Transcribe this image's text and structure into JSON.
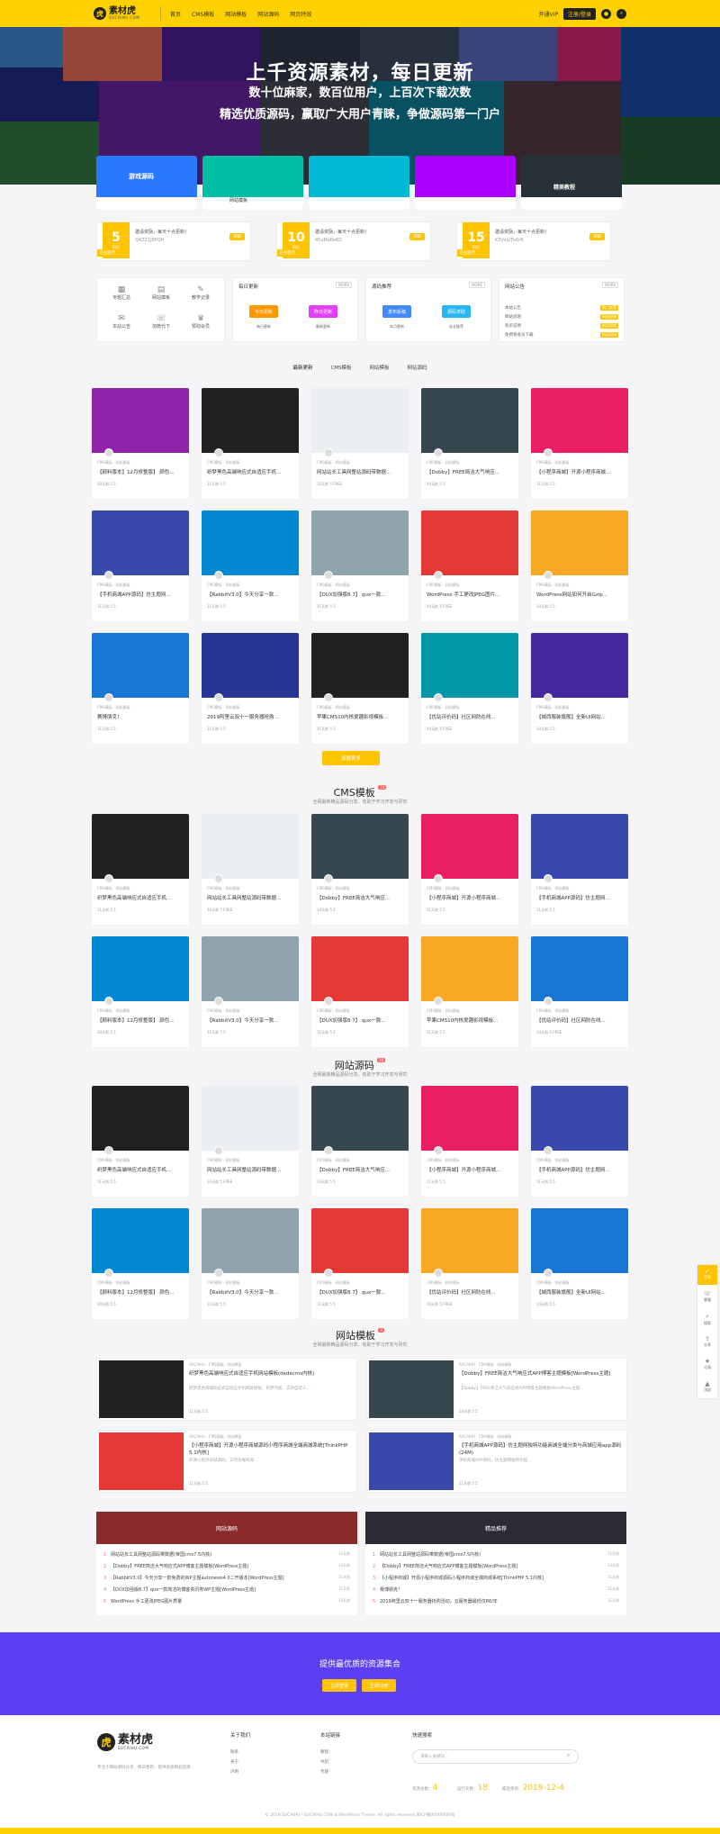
{
  "colors": {
    "brand_yellow": "#ffd100",
    "accent_orange": "#ffc400",
    "promo_purple": "#5b3ff0",
    "dark": "#222222"
  },
  "header": {
    "logo_text": "素材虎",
    "logo_sub": "SUCAIHU.COM",
    "nav": [
      "首页",
      "CMS模板",
      "网站模板",
      "网站源码",
      "网页特效"
    ],
    "vip_label": "开通VIP",
    "login_label": "注册/登录"
  },
  "hero": {
    "title": "上千资源素材，每日更新",
    "sub1": "数十位麻家，数百位用户，上百次下载次数",
    "sub2": "精选优质源码，赢取广大用户青睐，争做源码第一门户",
    "categories": [
      "游戏源码",
      "网站模板",
      "",
      "",
      "",
      "精美教程"
    ]
  },
  "stats": [
    {
      "num": "5",
      "unit": "积分",
      "text": "邀请奖励，每天十点更新！",
      "code": "Q4ZZ1J8PQH",
      "btn": "领取",
      "tag": "已经使用"
    },
    {
      "num": "10",
      "unit": "积分",
      "text": "邀请奖励，每天十点更新！",
      "code": "45xMeRe6D",
      "btn": "领取",
      "tag": "已经使用"
    },
    {
      "num": "15",
      "unit": "积分",
      "text": "邀请奖励，每天十点更新！",
      "code": "K3VsjuTk6rR",
      "btn": "领取",
      "tag": "已经使用"
    }
  ],
  "quick_grid": [
    "专题汇总",
    "网站模板",
    "教学记录",
    "本站公告",
    "加微代下",
    "赞助会员"
  ],
  "panels": [
    {
      "title": "每日更新",
      "more": "MORE",
      "buttons": [
        "今日更新",
        "昨日更新"
      ],
      "caps": [
        "每日更新",
        "最新更新"
      ]
    },
    {
      "title": "源码推荐",
      "more": "MORE",
      "buttons": [
        "发布投稿",
        "源码求助"
      ],
      "caps": [
        "本月更新",
        "站长推荐"
      ]
    },
    {
      "title": "网站公告",
      "more": "MORE"
    }
  ],
  "notices": [
    {
      "text": "本站公告",
      "badge": "热门推荐"
    },
    {
      "text": "网站说明",
      "badge": "网站说明"
    },
    {
      "text": "购买说明",
      "badge": "购买须知"
    },
    {
      "text": "免费将会员下载",
      "badge": "购买须知"
    }
  ],
  "tabs": [
    "最新更新",
    "CMS模板",
    "网站模板",
    "网站源码"
  ],
  "latest_posts": [
    {
      "title": "【颜料版本】12月修整版】 颜色...",
      "meta": "CMS模板 · 网站模板",
      "stats": "20天前  5  5"
    },
    {
      "title": "织梦黑色高端响应式自适应手机...",
      "meta": "CMS模板 · 网站模板",
      "stats": "11天前  5  5"
    },
    {
      "title": "网站站长工具网整站源码带数据...",
      "meta": "CMS模板 · 网站模板",
      "stats": "10天前  5  FREE"
    },
    {
      "title": "【Dobby】FREE简洁大气响应...",
      "meta": "CMS模板 · 网站模板",
      "stats": "14天前  5  5"
    },
    {
      "title": "【小程序商城】开源小程序商城...",
      "meta": "CMS模板 · 网站模板",
      "stats": "11天前  5  5"
    },
    {
      "title": "【手机商城APP源码】仿主题网...",
      "meta": "CMS模板 · 网站模板",
      "stats": "11天前  5  5"
    },
    {
      "title": "【RabbitV3.0】今天分享一款...",
      "meta": "CMS模板 · 网站模板",
      "stats": "11天前  5  5"
    },
    {
      "title": "【DUX加强版8.7】 qux一款...",
      "meta": "CMS模板 · 网站模板",
      "stats": "11天前  5  5"
    },
    {
      "title": "WordPress 手工更改JPEG图片...",
      "meta": "CMS模板 · 网站模板",
      "stats": "14天前  5  FREE"
    },
    {
      "title": "WordPress网站如何开启Gzip...",
      "meta": "CMS模板 · 网站模板",
      "stats": "14天前  5  5"
    },
    {
      "title": "赛博朋克！",
      "meta": "CMS模板 · 网站模板",
      "stats": "11天前  5  5"
    },
    {
      "title": "2019阿里云双十一服务器抢购...",
      "meta": "CMS模板 · 网站模板",
      "stats": "11天前  5  5"
    },
    {
      "title": "苹果CMS10内核爱趣影视模板...",
      "meta": "CMS模板 · 网站模板",
      "stats": "11天前  5  5"
    },
    {
      "title": "【优站评价码】社区网防在线...",
      "meta": "CMS模板 · 网站模板",
      "stats": "14天前  5  FREE"
    },
    {
      "title": "【城西服装旗舰】全新UI网站...",
      "meta": "CMS模板 · 网站模板",
      "stats": "14天前  5  5"
    }
  ],
  "more_button": "加载更多",
  "cms_section": {
    "title": "CMS模板",
    "badge": "10",
    "desc": "全网最新精品源码分享，有助于学习开发与研究",
    "posts": [
      {
        "title": "织梦黑色高端响应式自适应手机...",
        "meta": "CMS模板 · 网站模板",
        "stats": "11天前  5  5"
      },
      {
        "title": "网站站长工具网整站源码带数据...",
        "meta": "CMS模板 · 网站模板",
        "stats": "10天前  5  FREE"
      },
      {
        "title": "【Dobby】FREE简洁大气响应...",
        "meta": "CMS模板 · 网站模板",
        "stats": "14天前  5  5"
      },
      {
        "title": "【小程序商城】开源小程序商城...",
        "meta": "CMS模板 · 网站模板",
        "stats": "11天前  5  5"
      },
      {
        "title": "【手机商城APP源码】仿主题网...",
        "meta": "CMS模板 · 网站模板",
        "stats": "11天前  5  5"
      },
      {
        "title": "【颜料版本】12月修整版】 颜色...",
        "meta": "CMS模板 · 网站模板",
        "stats": "20天前  5  5"
      },
      {
        "title": "【RabbitV3.0】今天分享一款...",
        "meta": "CMS模板 · 网站模板",
        "stats": "11天前  5  5"
      },
      {
        "title": "【DUX加强版8.7】 qux一款...",
        "meta": "CMS模板 · 网站模板",
        "stats": "11天前  5  5"
      },
      {
        "title": "苹果CMS10内核爱趣影视模板...",
        "meta": "CMS模板 · 网站模板",
        "stats": "11天前  5  5"
      },
      {
        "title": "【优站评价码】社区网防在线...",
        "meta": "CMS模板 · 网站模板",
        "stats": "14天前  5  FREE"
      }
    ]
  },
  "source_section": {
    "title": "网站源码",
    "badge": "10",
    "desc": "全网最新精品源码分享，有助于学习开发与研究",
    "posts": [
      {
        "title": "织梦黑色高端响应式自适应手机...",
        "meta": "CMS模板 · 网站模板",
        "stats": "11天前  5  5"
      },
      {
        "title": "网站站长工具网整站源码带数据...",
        "meta": "CMS模板 · 网站模板",
        "stats": "10天前  5  FREE"
      },
      {
        "title": "【Dobby】FREE简洁大气响应...",
        "meta": "CMS模板 · 网站模板",
        "stats": "14天前  5  5"
      },
      {
        "title": "【小程序商城】开源小程序商城...",
        "meta": "CMS模板 · 网站模板",
        "stats": "11天前  5  5"
      },
      {
        "title": "【手机商城APP源码】仿主题网...",
        "meta": "CMS模板 · 网站模板",
        "stats": "11天前  5  5"
      },
      {
        "title": "【颜料版本】12月修整版】 颜色...",
        "meta": "CMS模板 · 网站模板",
        "stats": "20天前  5  5"
      },
      {
        "title": "【RabbitV3.0】今天分享一款...",
        "meta": "CMS模板 · 网站模板",
        "stats": "11天前  5  5"
      },
      {
        "title": "【DUX加强版8.7】 qux一款...",
        "meta": "CMS模板 · 网站模板",
        "stats": "11天前  5  5"
      },
      {
        "title": "【优站评价码】社区网防在线...",
        "meta": "CMS模板 · 网站模板",
        "stats": "14天前  5  FREE"
      },
      {
        "title": "【城西服装旗舰】全新UI网站...",
        "meta": "CMS模板 · 网站模板",
        "stats": "14天前  5  5"
      }
    ]
  },
  "template_section": {
    "title": "网站模板",
    "badge": "4",
    "desc": "全网最新精品源码分享，有助于学习开发与研究",
    "posts": [
      {
        "title": "织梦黑色高端响应式自适应手机网站模板(dedecms内核)",
        "meta": "SUCAIHU · CMS模板 · 网站模板",
        "desc": "织梦黑色高端响应式自适应手机网站模板，织梦内核，支持自定义...",
        "stats": "11天前  5  5"
      },
      {
        "title": "【Dobby】FREE简洁大气响应式APP博客主题模板[WordPress主题]",
        "meta": "SUCAIHU · CMS模板 · 网站模板",
        "desc": "【Dobby】FREE简洁大气响应式APP博客主题模板WordPress主题...",
        "stats": "14天前  5  5"
      },
      {
        "title": "【小程序商城】开源小程序商城源码小程序商城全端商城系统[ThinkPHP 5.1内核]",
        "meta": "SUCAIHU · CMS模板 · 网站模板",
        "desc": "开源小程序商城源码，支持多端商城...",
        "stats": "11天前  5  5"
      },
      {
        "title": "【手机商城APP源码】仿主题网独特功能商城全端分类与商城应用app源码(24M)",
        "meta": "SUCAIHU · CMS模板 · 网站模板",
        "desc": "手机商城APP源码，仿主题网独特功能...",
        "stats": "11天前  5  5"
      }
    ]
  },
  "rank_left": {
    "title": "网站源码",
    "sub": "全网最新精品源码分享",
    "items": [
      {
        "n": "1",
        "text": "网站站长工具网整站源码带数据(帝国cms7.5内核)",
        "date": "11天前"
      },
      {
        "n": "2",
        "text": "【Dobby】FREE简洁大气响应式APP博客主题模板[WordPress主题]",
        "date": "14天前"
      },
      {
        "n": "3",
        "text": "【RabbitV3.0】今天分享一款免费的WP主题autonews4.0二开版本[WordPress主题]",
        "date": "11天前"
      },
      {
        "n": "4",
        "text": "【DUX加强版8.7】qux一款简洁的博客资讯类WP主题[WordPress主题]",
        "date": "11天前"
      },
      {
        "n": "5",
        "text": "WordPress 手工更改JPEG图片质量",
        "date": "14天前"
      }
    ]
  },
  "rank_right": {
    "title": "精品推荐",
    "sub": "全网最新精品源码分享",
    "items": [
      {
        "n": "1",
        "text": "网站站长工具网整站源码带数据(帝国cms7.5内核)",
        "date": "11天前"
      },
      {
        "n": "2",
        "text": "【Dobby】FREE简洁大气响应式APP博客主题模板[WordPress主题]",
        "date": "14天前"
      },
      {
        "n": "3",
        "text": "【小程序商城】开源小程序商城源码小程序商城全端商城系统[ThinkPHP 5.1内核]",
        "date": "11天前"
      },
      {
        "n": "4",
        "text": "赛博朋克！",
        "date": "11天前"
      },
      {
        "n": "5",
        "text": "2019阿里云双十一服务器抢购活动，云服务器最低仅86/年",
        "date": "11天前"
      }
    ]
  },
  "promo": {
    "title": "提供最优质的资源集合",
    "btn1": "立即登录",
    "btn2": "立即注册"
  },
  "footer": {
    "logo_text": "素材虎",
    "logo_sub": "SUCAIHU.COM",
    "desc": "专注于网站源码分享，每日更新，提供优质精品资源...",
    "col1_title": "关于我们",
    "col1_links": [
      "联系",
      "关于",
      "声明"
    ],
    "col2_title": "本站链接",
    "col2_links": [
      "教程",
      "导航",
      "专题"
    ],
    "col3_title": "快速搜索",
    "search_placeholder": "请输入关键词...",
    "stat1_label": "资源总数：",
    "stat1_value": "4",
    "stat2_label": "运行天数：",
    "stat2_value": "18",
    "stat3_label": "最后更新：",
    "stat3_value": "2019-12-4",
    "copyright": "© 2019 SUCAIHU · SUCAIHU.COM & WordPress Theme. All rights reserved 浙ICP备00000000号"
  },
  "side": [
    "签到",
    "客服",
    "搜索",
    "分享",
    "订阅",
    "顶部"
  ]
}
